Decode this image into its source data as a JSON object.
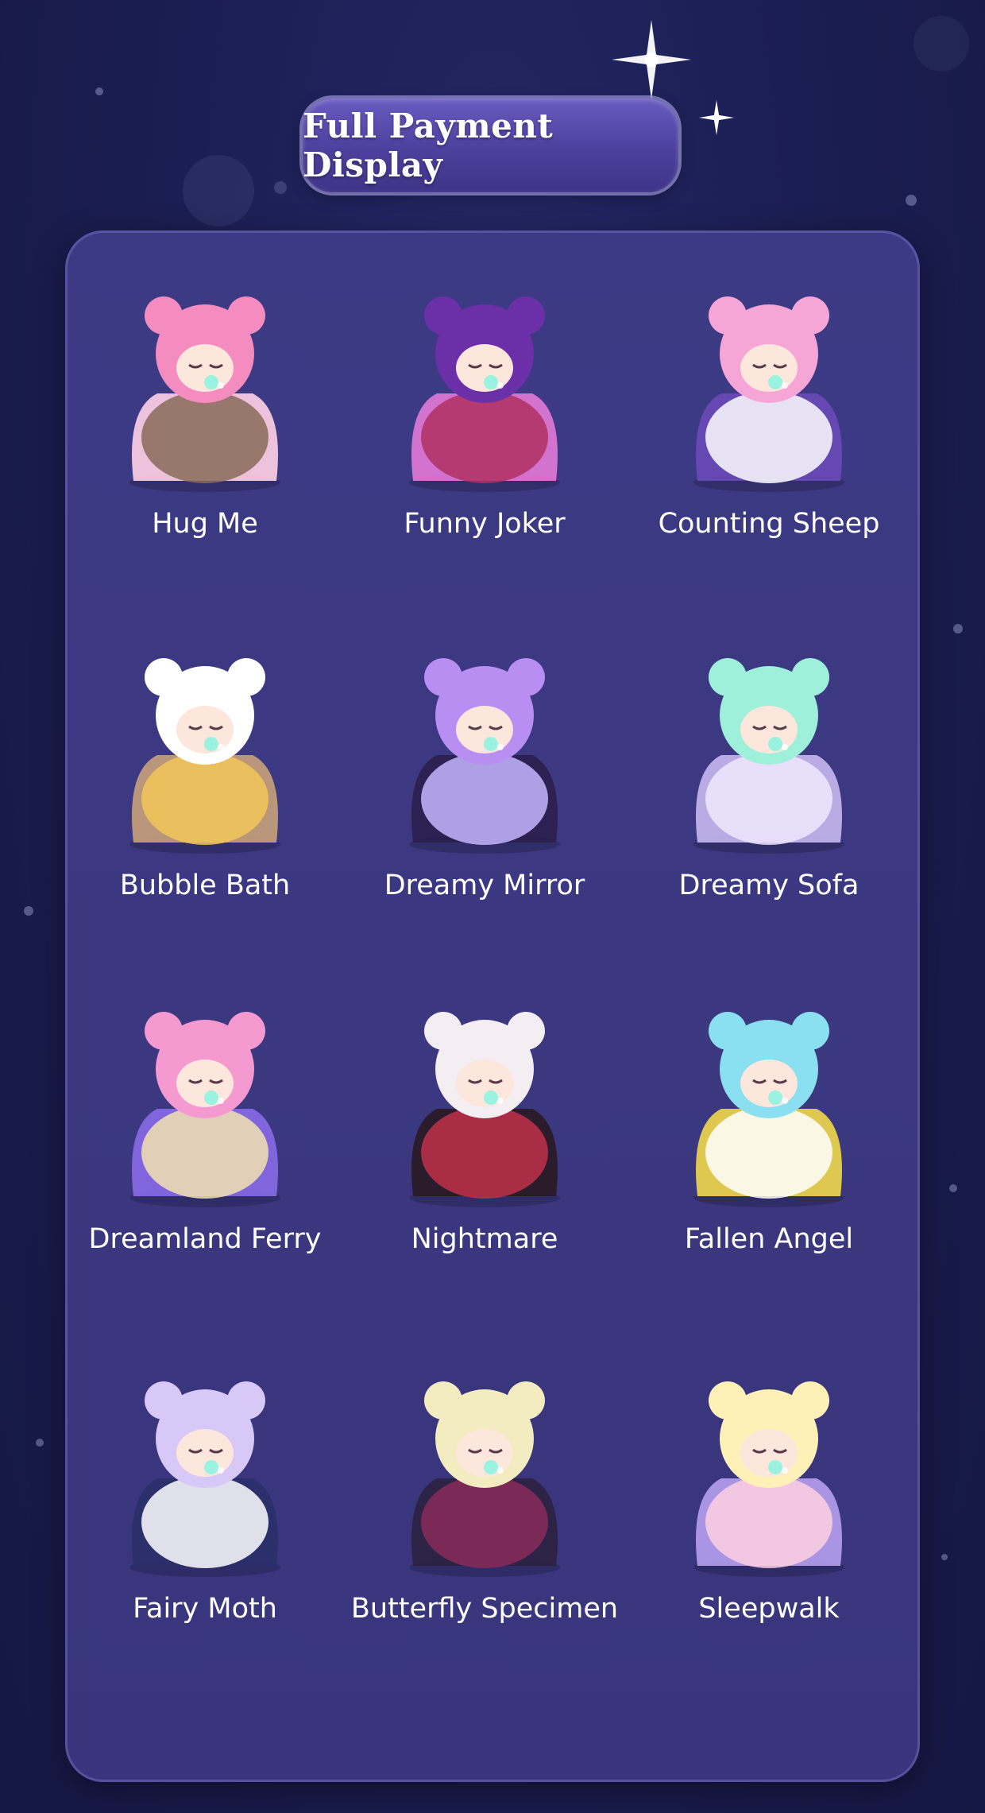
{
  "header": {
    "title": "Full Payment Display"
  },
  "items": [
    {
      "label": "Hug Me",
      "icon": "pink-bear-figure-icon",
      "colors": [
        "#f58cc0",
        "#ffd2e6",
        "#8a6a58"
      ]
    },
    {
      "label": "Funny Joker",
      "icon": "jester-rose-figure-icon",
      "colors": [
        "#6b2fa8",
        "#e27ad8",
        "#b03060"
      ]
    },
    {
      "label": "Counting Sheep",
      "icon": "sheep-bed-figure-icon",
      "colors": [
        "#f6a6d6",
        "#6a4ab8",
        "#ffffff"
      ]
    },
    {
      "label": "Bubble Bath",
      "icon": "bathtub-figure-icon",
      "colors": [
        "#ffffff",
        "#c8a27a",
        "#f2c75a"
      ]
    },
    {
      "label": "Dreamy Mirror",
      "icon": "mirror-figure-icon",
      "colors": [
        "#b88ef2",
        "#2a1f4a",
        "#c7b6ff"
      ]
    },
    {
      "label": "Dreamy Sofa",
      "icon": "sofa-figure-icon",
      "colors": [
        "#9ff0da",
        "#c8b8f0",
        "#f0e8ff"
      ]
    },
    {
      "label": "Dreamland Ferry",
      "icon": "paper-boat-figure-icon",
      "colors": [
        "#f59ad0",
        "#8a6ae8",
        "#f2e2b0"
      ]
    },
    {
      "label": "Nightmare",
      "icon": "bunny-hood-figure-icon",
      "colors": [
        "#f4eef2",
        "#2a1a22",
        "#c0304a"
      ]
    },
    {
      "label": "Fallen Angel",
      "icon": "angel-wings-figure-icon",
      "colors": [
        "#8ae0f0",
        "#f2d84a",
        "#ffffff"
      ]
    },
    {
      "label": "Fairy Moth",
      "icon": "moth-fairy-figure-icon",
      "colors": [
        "#d8c8f8",
        "#2a2f6a",
        "#ffffff"
      ]
    },
    {
      "label": "Butterfly Specimen",
      "icon": "butterfly-frame-figure-icon",
      "colors": [
        "#f2ecc0",
        "#2b2140",
        "#8a2a5a"
      ]
    },
    {
      "label": "Sleepwalk",
      "icon": "sleepwalk-lamp-figure-icon",
      "colors": [
        "#fff0b8",
        "#b7a0f0",
        "#ffd0e0"
      ]
    }
  ]
}
